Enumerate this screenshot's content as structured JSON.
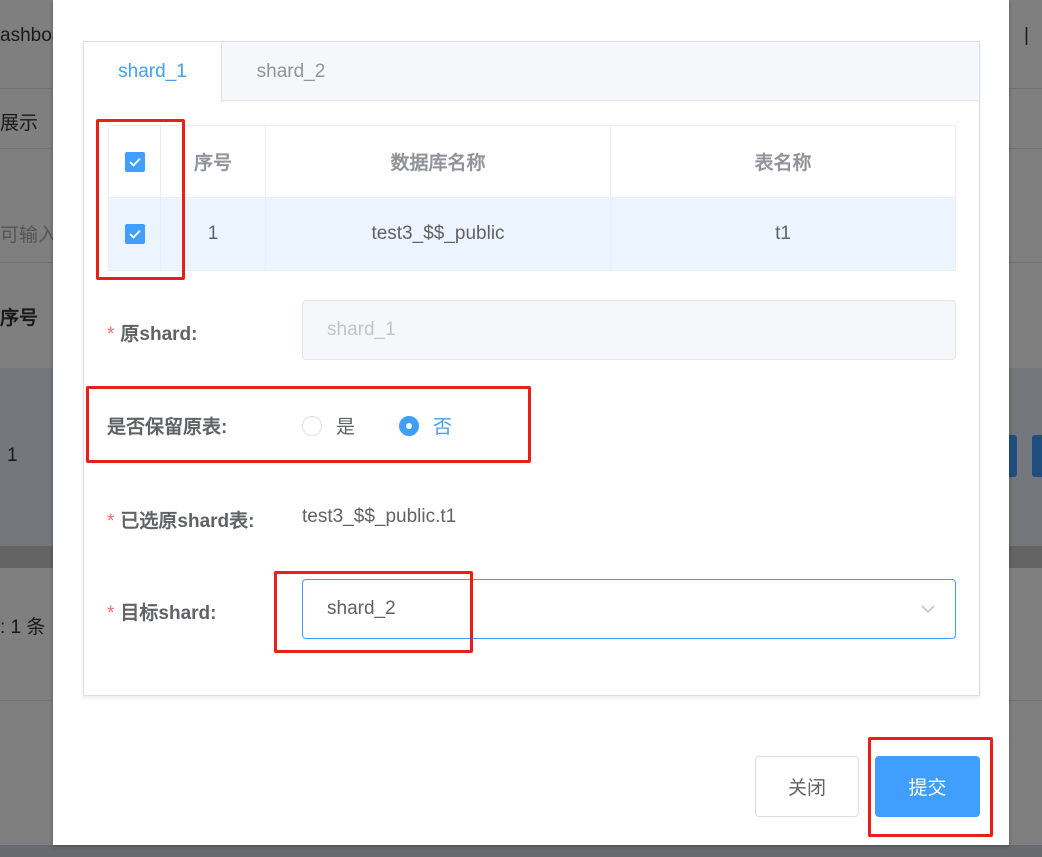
{
  "background": {
    "top_text": "ashboa",
    "row_label": "展示",
    "input_hint": "可输入",
    "col_header": "序号",
    "row_index": "1",
    "total_text": ": 1 条",
    "divider_char": "|"
  },
  "tabs": [
    {
      "label": "shard_1",
      "active": true
    },
    {
      "label": "shard_2",
      "active": false
    }
  ],
  "table": {
    "columns": [
      "序号",
      "数据库名称",
      "表名称"
    ],
    "rows": [
      {
        "index": "1",
        "database": "test3_$$_public",
        "table": "t1",
        "checked": true
      }
    ],
    "header_checked": true
  },
  "form": {
    "source_shard": {
      "label": "原shard:",
      "required": true,
      "value": "shard_1",
      "disabled": true
    },
    "keep_source": {
      "label": "是否保留原表:",
      "options": [
        "是",
        "否"
      ],
      "selected": "否"
    },
    "selected_tables": {
      "label": "已选原shard表:",
      "required": true,
      "value": "test3_$$_public.t1"
    },
    "target_shard": {
      "label": "目标shard:",
      "required": true,
      "value": "shard_2"
    }
  },
  "footer": {
    "close_label": "关闭",
    "submit_label": "提交"
  },
  "colors": {
    "primary": "#409eff",
    "required": "#f56c6c",
    "annotation": "#e8201a"
  },
  "icons": [
    "check-icon",
    "chevron-down-icon"
  ]
}
